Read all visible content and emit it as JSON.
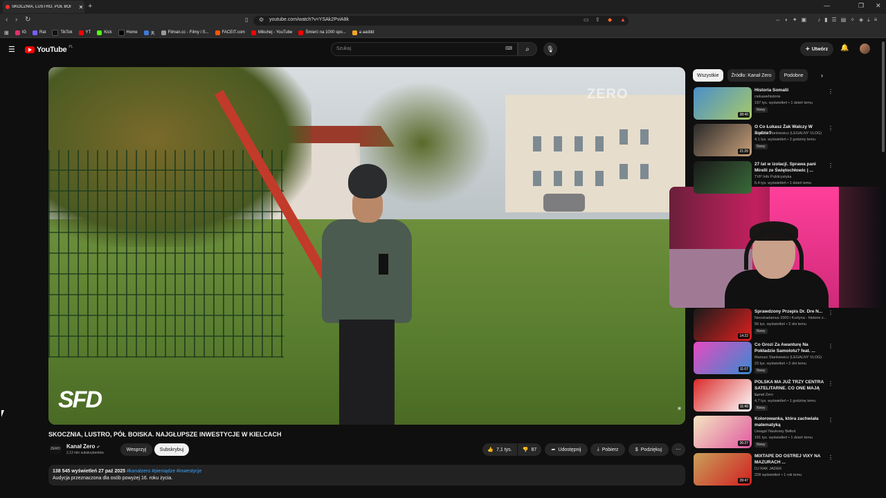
{
  "browser": {
    "tab_title": "SKOCZNIA, LUSTRO, PÓŁ BOI",
    "url": "youtube.com/watch?v=YSAk2PviA8k",
    "bookmarks": [
      {
        "label": "IG",
        "color": "#e1306c"
      },
      {
        "label": "Rat",
        "color": "#7b5cff"
      },
      {
        "label": "TikTok",
        "color": "#111111"
      },
      {
        "label": "YT",
        "color": "#ff0000"
      },
      {
        "label": "Kick",
        "color": "#53fc18"
      },
      {
        "label": "Home",
        "color": "#000000"
      },
      {
        "label": "天",
        "color": "#3d7bd9"
      },
      {
        "label": "Filman.cc - Filmy i S...",
        "color": "#999999"
      },
      {
        "label": "FACEIT.com",
        "color": "#ff5500"
      },
      {
        "label": "Mikuhej - YouTube",
        "color": "#ff0000"
      },
      {
        "label": "Śmierć na 1000 spo...",
        "color": "#ff0000"
      },
      {
        "label": "a aaddd",
        "color": "#f5a623"
      }
    ]
  },
  "youtube": {
    "logo_text": "YouTube",
    "logo_country": "PL",
    "search_placeholder": "Szukaj",
    "create_label": "Utwórz"
  },
  "video": {
    "watermark": "ZERO",
    "overlay_logo": "SFD",
    "title": "SKOCZNIA, LUSTRO, PÓŁ BOISKA. NAJGŁUPSZE INWESTYCJE W KIELCACH",
    "channel": "Kanał Zero",
    "channel_avatar": "ZERO",
    "subscribers": "2,12 mln subskrybentów",
    "support_label": "Wesprzyj",
    "subscribe_label": "Subskrybuj",
    "likes": "7,1 tys.",
    "dislikes": "87",
    "share_label": "Udostępnij",
    "download_label": "Pobierz",
    "thanks_label": "Podziękuj",
    "views_date": "138 545 wyświetleń  27 paź 2025",
    "hashtags": "#kanalzero #pieniądze #inwestycje",
    "description": "Audycja przeznaczona dla osób powyżej 16. roku życia."
  },
  "sidebar": {
    "chips": [
      "Wszystkie",
      "Źródło: Kanał Zero",
      "Podobne"
    ],
    "recommendations": [
      {
        "title": "Historia Somalii",
        "channel": "ciekawehistorie",
        "meta": "197 tys. wyświetleń • 1 dzień temu",
        "badge": "Nowy",
        "duration": "38:40",
        "color1": "#4a8fc9",
        "color2": "#a8c96a"
      },
      {
        "title": "O Co Łukasz Żak Walczy W Sądzie?",
        "channel": "Mariusz Stankiewicz (LEGALNY VLOG)",
        "meta": "4,1 tys. wyświetleń • 2 godziny temu",
        "badge": "Nowy",
        "duration": "21:20",
        "color1": "#2a2a2a",
        "color2": "#c9a07a"
      },
      {
        "title": "27 lat w izolacji. Sprawa pani Mirelli ze Świętochłowic | ...",
        "channel": "TVP Info Publicystyka",
        "meta": "6,4 tys. wyświetleń • 1 dzień temu",
        "badge": "",
        "duration": "",
        "color1": "#1a1a1a",
        "color2": "#3a6a3a"
      },
      {
        "title": "Sprawdzony Przepis Dr. Dre N...",
        "channel": "Neostradamus 2000 i Kurtyna - historie z...",
        "meta": "56 tys. wyświetleń • 2 dni temu",
        "badge": "Nowy",
        "duration": "14:22",
        "color1": "#1a1a1a",
        "color2": "#e02020"
      },
      {
        "title": "Co Grozi Za Awanturę Na Pokładzie Samolotu? feat. ...",
        "channel": "Mariusz Stankiewicz (LEGALNY VLOG)",
        "meta": "23 tys. wyświetleń • 2 dni temu",
        "badge": "Nowy",
        "duration": "11:07",
        "color1": "#e64ac0",
        "color2": "#3a8ad0"
      },
      {
        "title": "POLSKA MA JUŻ TRZY CENTRA SATELITARNE. CO ONE MAJĄ ...",
        "channel": "Kanał Zero",
        "meta": "4,7 tys. wyświetleń • 1 godzinę temu",
        "badge": "Nowy",
        "duration": "11:40",
        "color1": "#d92a2a",
        "color2": "#ffffff"
      },
      {
        "title": "Kolorowanka, która zachwiała matematyką",
        "channel": "Uwaga! Naukowy Bełkot",
        "meta": "191 tys. wyświetleń • 1 dzień temu",
        "badge": "Nowy",
        "duration": "26:27",
        "color1": "#f4e5c0",
        "color2": "#e05aa0"
      },
      {
        "title": "MIXTAPE DO OSTREJ VIXY NA MAZURACH ...",
        "channel": "DJ RAK JADER",
        "meta": "228 wyświetleń • 1 rok temu",
        "badge": "",
        "duration": "39:47",
        "color1": "#c9a05a",
        "color2": "#d02020"
      }
    ]
  },
  "colors": {
    "accent": "#ff0000",
    "link": "#3ea6ff",
    "background": "#0f0f0f"
  }
}
